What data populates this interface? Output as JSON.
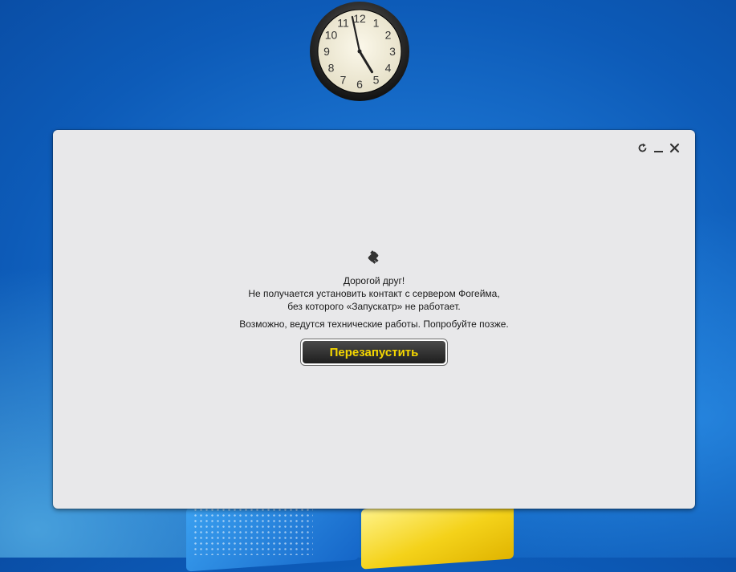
{
  "desktop": {
    "clock": {
      "numerals": [
        "12",
        "1",
        "2",
        "3",
        "4",
        "5",
        "6",
        "7",
        "8",
        "9",
        "10",
        "11"
      ],
      "time": {
        "hour": 4,
        "minute": 58
      }
    }
  },
  "dialog": {
    "controls": {
      "refresh_icon": "refresh-icon",
      "minimize_icon": "minimize-icon",
      "close_icon": "close-icon"
    },
    "icon": "plug-icon",
    "message": {
      "greeting": "Дорогой друг!",
      "line1": "Не получается установить контакт с сервером Фогейма,",
      "line2": "без которого «Запускатр» не работает.",
      "line3": "Возможно, ведутся технические работы. Попробуйте позже."
    },
    "restart_button": "Перезапустить",
    "colors": {
      "button_text": "#f5d700",
      "button_bg": "#2a2a2a",
      "window_bg": "#e8e8ea"
    }
  }
}
